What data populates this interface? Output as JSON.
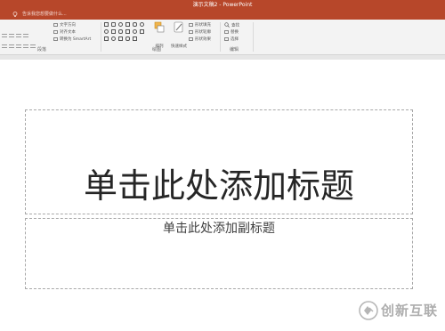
{
  "window": {
    "title": "演示文稿2 - PowerPoint"
  },
  "tellme": {
    "text": "告诉我您想要做什么..."
  },
  "ribbon": {
    "paragraph": {
      "label": "段落",
      "commands": [
        "文字方向",
        "对齐文本",
        "转换为 SmartArt"
      ]
    },
    "drawing": {
      "label": "绘图",
      "arrange_label": "排列",
      "quick_styles_label": "快速样式",
      "commands": [
        "形状填充",
        "形状轮廓",
        "形状效果"
      ]
    },
    "editing": {
      "label": "编辑",
      "commands": [
        "查找",
        "替换",
        "选择"
      ]
    }
  },
  "slide": {
    "title_placeholder": "单击此处添加标题",
    "subtitle_placeholder": "单击此处添加副标题"
  },
  "watermark": {
    "text": "创新互联"
  },
  "colors": {
    "accent": "#b7472a",
    "ribbon_bg": "#f3f3f3",
    "slide_bg": "#ffffff"
  }
}
